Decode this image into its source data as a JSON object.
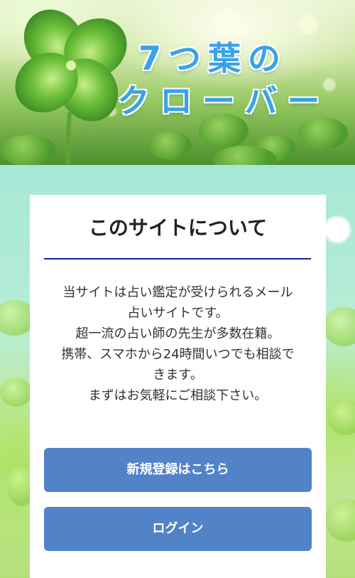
{
  "header": {
    "title_line1": "7つ葉の",
    "title_line2": "クローバー"
  },
  "about": {
    "heading": "このサイトについて",
    "lines": [
      "当サイトは占い鑑定が受けられるメール",
      "占いサイトです。",
      "超一流の占い師の先生が多数在籍。",
      "携帯、スマホから24時間いつでも相談で",
      "きます。",
      "まずはお気軽にご相談下さい。"
    ]
  },
  "actions": {
    "register_label": "新規登録はこちら",
    "login_label": "ログイン"
  },
  "colors": {
    "title_blue": "#3aa2e6",
    "divider_navy": "#121e8a",
    "button_blue": "#5282c8"
  },
  "icons": [
    "clover-icon"
  ]
}
